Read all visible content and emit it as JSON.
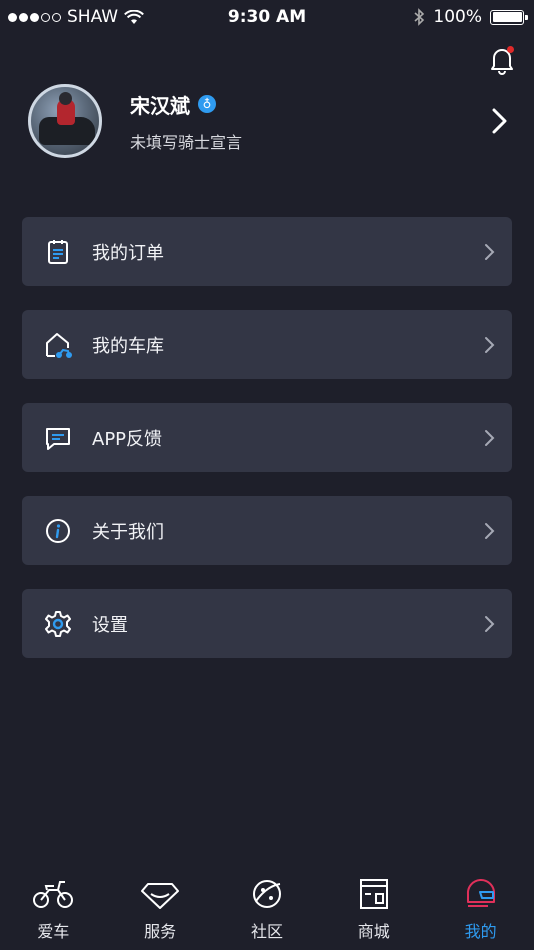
{
  "status_bar": {
    "carrier": "SHAW",
    "time": "9:30 AM",
    "battery": "100%"
  },
  "profile": {
    "name": "宋汉斌",
    "verified_badge": "♁",
    "motto": "未填写骑士宣言"
  },
  "menu": [
    {
      "label": "我的订单",
      "icon": "order-icon"
    },
    {
      "label": "我的车库",
      "icon": "garage-icon"
    },
    {
      "label": "APP反馈",
      "icon": "feedback-icon"
    },
    {
      "label": "关于我们",
      "icon": "info-icon"
    },
    {
      "label": "设置",
      "icon": "gear-icon"
    }
  ],
  "tabs": [
    {
      "label": "爱车",
      "icon": "motorcycle-icon"
    },
    {
      "label": "服务",
      "icon": "diamond-icon"
    },
    {
      "label": "社区",
      "icon": "planet-icon"
    },
    {
      "label": "商城",
      "icon": "store-icon"
    },
    {
      "label": "我的",
      "icon": "helmet-icon",
      "active": true
    }
  ],
  "colors": {
    "background": "#1e1f2a",
    "card": "#333645",
    "accent": "#2f9bf0",
    "notification_dot": "#e02a2a"
  }
}
